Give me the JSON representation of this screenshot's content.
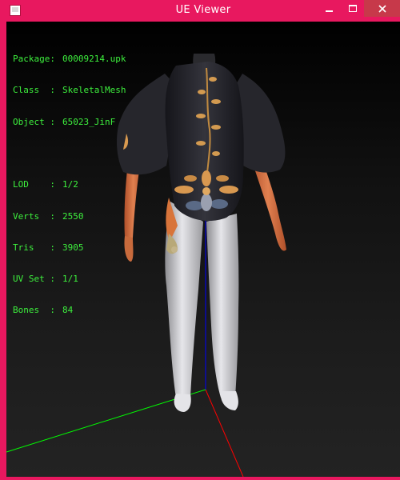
{
  "window": {
    "title": "UE Viewer",
    "icon": "app-icon",
    "controls": [
      "minimize-icon",
      "maximize-icon",
      "close-icon"
    ],
    "accent": "#e8185f"
  },
  "info": {
    "color": "#3df03d",
    "package": {
      "key": "Package:",
      "value": "00009214.upk"
    },
    "class": {
      "key": "Class  :",
      "value": "SkeletalMesh"
    },
    "object": {
      "key": "Object :",
      "value": "65023_JinF"
    },
    "lod": {
      "key": "LOD    :",
      "value": "1/2"
    },
    "verts": {
      "key": "Verts  :",
      "value": "2550"
    },
    "tris": {
      "key": "Tris   :",
      "value": "3905"
    },
    "uvset": {
      "key": "UV Set :",
      "value": "1/1"
    },
    "bones": {
      "key": "Bones  :",
      "value": "84"
    }
  },
  "viewport": {
    "axis_colors": {
      "x": "#ff0000",
      "y": "#00ff00",
      "z": "#0000ff"
    }
  }
}
